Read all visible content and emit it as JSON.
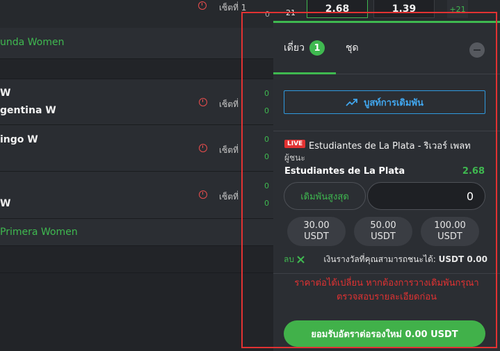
{
  "top_strip": {
    "set_label": "เซ็ตที่ 1",
    "score": "21",
    "odds": [
      "2.68",
      "1.39"
    ],
    "more_markets": "+21"
  },
  "left_list": {
    "leagues": [
      "unda Women",
      "Primera Women"
    ],
    "matches": [
      {
        "team1": "W",
        "team2": "gentina W",
        "set_label": "เซ็ตที่",
        "score1": "0",
        "score2": "0"
      },
      {
        "team1": "ingo W",
        "team2": "",
        "set_label": "เซ็ตที่",
        "score1": "0",
        "score2": "0"
      },
      {
        "team1": "",
        "team2": "W",
        "set_label": "เซ็ตที่",
        "score1": "0",
        "score2": "0"
      }
    ],
    "score_left": "0"
  },
  "bet_slip": {
    "tabs": {
      "single": "เดี่ยว",
      "single_count": "1",
      "combo": "ชุด"
    },
    "boost_label": "บูสท์การเดิมพัน",
    "live_badge": "LIVE",
    "match_title": "Estudiantes de La Plata - ริเวอร์ เพลท",
    "market": "ผู้ชนะ",
    "selection": "Estudiantes de La Plata",
    "selection_odds": "2.68",
    "max_bet_label": "เดิมพันสูงสุด",
    "stake_value": "0",
    "quick_amounts": [
      {
        "amount": "30.00",
        "currency": "USDT"
      },
      {
        "amount": "50.00",
        "currency": "USDT"
      },
      {
        "amount": "100.00",
        "currency": "USDT"
      }
    ],
    "clear_label": "ลบ",
    "possible_win_label": "เงินรางวัลที่คุณสามารถชนะได้:",
    "possible_win_value": "USDT 0.00",
    "warning_line1": "ราคาต่อได้เปลี่ยน หากต้องการวางเดิมพันกรุณา",
    "warning_line2": "ตรวจสอบรายละเอียดก่อน",
    "accept_label": "ยอมรับอัตราต่อรองใหม่  0.00 USDT"
  },
  "colors": {
    "accent_green": "#3fb950",
    "live_red": "#e23232",
    "boost_blue": "#2f9ae0",
    "highlight_frame": "#e23232"
  }
}
